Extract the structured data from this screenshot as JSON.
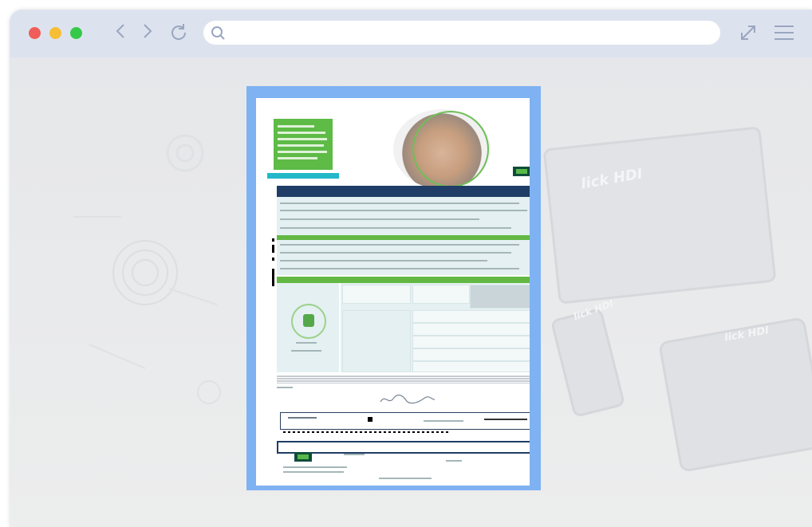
{
  "browser": {
    "traffic_lights": {
      "close": "#f05e5a",
      "minimize": "#f6be35",
      "maximize": "#35c94a"
    },
    "nav_icons": [
      "back-icon",
      "forward-icon",
      "reload-icon"
    ],
    "search": {
      "icon": "search-icon",
      "value": "",
      "placeholder": ""
    },
    "right_icons": [
      "expand-icon",
      "menu-icon"
    ]
  },
  "background": {
    "watermarks": [
      "lick HDI",
      "lick HDI",
      "lick HDI"
    ]
  },
  "document": {
    "frame_color": "#7fb2f2",
    "accent_green": "#63b844",
    "accent_navy": "#1f3d66",
    "accent_teal": "#22b8c8"
  }
}
